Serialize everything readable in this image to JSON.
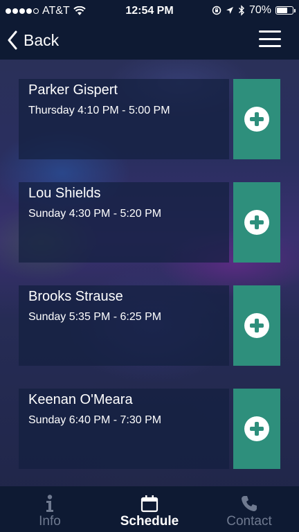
{
  "status_bar": {
    "carrier": "AT&T",
    "time": "12:54 PM",
    "battery": "70%",
    "battery_level": 0.7
  },
  "nav": {
    "back_label": "Back"
  },
  "schedule": [
    {
      "name": "Parker Gispert",
      "time": "Thursday  4:10 PM - 5:00 PM"
    },
    {
      "name": "Lou Shields",
      "time": "Sunday  4:30 PM - 5:20 PM"
    },
    {
      "name": "Brooks Strause",
      "time": "Sunday  5:35 PM - 6:25 PM"
    },
    {
      "name": "Keenan O'Meara",
      "time": "Sunday  6:40 PM - 7:30 PM"
    }
  ],
  "tabs": [
    {
      "label": "Info",
      "icon": "info-icon",
      "active": false
    },
    {
      "label": "Schedule",
      "icon": "calendar-icon",
      "active": true
    },
    {
      "label": "Contact",
      "icon": "phone-icon",
      "active": false
    }
  ],
  "colors": {
    "bar_background": "#0e1a33",
    "accent_teal": "#2e8f7c",
    "inactive_tab": "#6f7a90"
  }
}
